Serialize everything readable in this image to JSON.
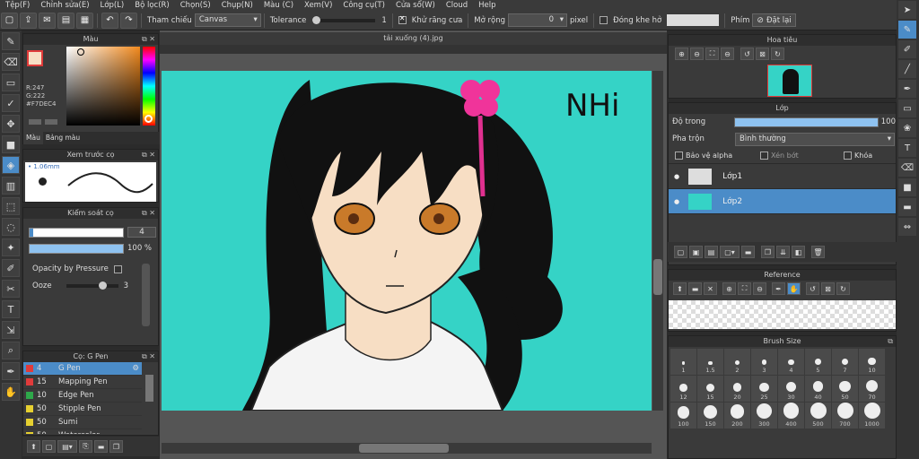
{
  "menu": [
    "Tệp(F)",
    "Chỉnh sửa(E)",
    "Lớp(L)",
    "Bộ lọc(R)",
    "Chọn(S)",
    "Chụp(N)",
    "Màu (C)",
    "Xem(V)",
    "Công cụ(T)",
    "Cửa sổ(W)",
    "Cloud",
    "Help"
  ],
  "toolbar": {
    "ref_label": "Tham chiếu",
    "ref_value": "Canvas",
    "tolerance_label": "Tolerance",
    "tolerance_value": "1",
    "antialias_label": "Khử răng cưa",
    "expand_label": "Mở rộng",
    "expand_value": "0",
    "expand_unit": "pixel",
    "gap_label": "Đóng khe hở",
    "key_label": "Phím",
    "reset_label": "Đặt lại"
  },
  "color_panel": {
    "title": "Màu",
    "r": "R:247",
    "g": "G:222",
    "hex": "#F7DEC4",
    "tab_color": "Màu",
    "tab_palette": "Bảng màu",
    "fg_color": "#f7dec4",
    "accent": "#e03b3b"
  },
  "preview_panel": {
    "title": "Xem trước cọ",
    "size": "1.06mm"
  },
  "brush_control": {
    "title": "Kiểm soát cọ",
    "size_value": "4",
    "opacity_value": "100 %",
    "pressure_label": "Opacity by Pressure",
    "ooze_label": "Ooze",
    "ooze_value": "3"
  },
  "brush_list": {
    "title": "Cọ: G Pen",
    "items": [
      {
        "num": "4",
        "name": "G Pen",
        "color": "#e03b3b"
      },
      {
        "num": "15",
        "name": "Mapping Pen",
        "color": "#e03b3b"
      },
      {
        "num": "10",
        "name": "Edge Pen",
        "color": "#2ea84a"
      },
      {
        "num": "50",
        "name": "Stipple Pen",
        "color": "#e6d030"
      },
      {
        "num": "50",
        "name": "Sumi",
        "color": "#e6d030"
      },
      {
        "num": "50",
        "name": "Watercolor",
        "color": "#e6d030"
      }
    ]
  },
  "document": {
    "tab": "tải xuống (4).jpg",
    "signature": "NHi"
  },
  "navigator": {
    "title": "Hoa tiêu"
  },
  "layer_panel": {
    "title": "Lớp",
    "opacity_label": "Độ trong",
    "opacity_value": "100",
    "blend_label": "Pha trộn",
    "blend_value": "Bình thường",
    "protect_alpha": "Bảo vệ alpha",
    "clip": "Xén bớt",
    "lock": "Khóa",
    "layers": [
      {
        "name": "Lớp1"
      },
      {
        "name": "Lớp2"
      }
    ]
  },
  "reference": {
    "title": "Reference"
  },
  "brush_size": {
    "title": "Brush Size",
    "sizes": [
      "1",
      "1.5",
      "2",
      "3",
      "4",
      "5",
      "7",
      "10",
      "12",
      "15",
      "20",
      "25",
      "30",
      "40",
      "50",
      "70",
      "100",
      "150",
      "200",
      "300",
      "400",
      "500",
      "700",
      "1000"
    ]
  }
}
